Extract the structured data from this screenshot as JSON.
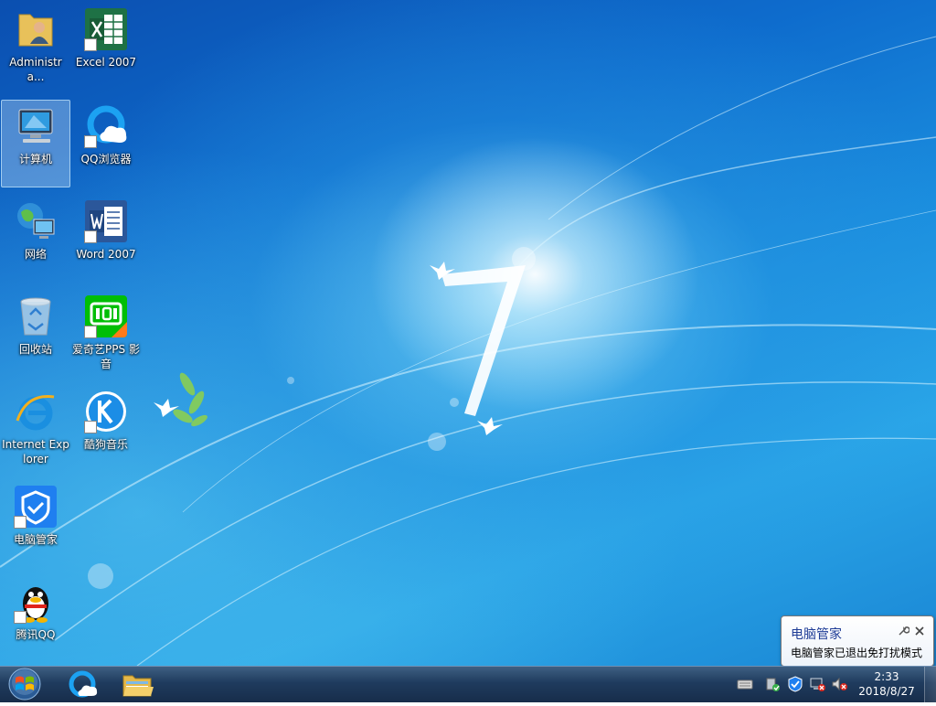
{
  "desktop_icons": [
    {
      "label": "Administra...",
      "icon": "user-folder-icon",
      "shortcut": false
    },
    {
      "label": "Excel 2007",
      "icon": "excel-icon",
      "shortcut": true
    },
    {
      "label": "计算机",
      "icon": "computer-icon",
      "shortcut": false,
      "selected": true
    },
    {
      "label": "QQ浏览器",
      "icon": "qq-browser-icon",
      "shortcut": true
    },
    {
      "label": "网络",
      "icon": "network-icon",
      "shortcut": false
    },
    {
      "label": "Word 2007",
      "icon": "word-icon",
      "shortcut": true
    },
    {
      "label": "回收站",
      "icon": "recycle-bin-icon",
      "shortcut": false
    },
    {
      "label": "爱奇艺PPS 影音",
      "icon": "iqiyi-icon",
      "shortcut": true
    },
    {
      "label": "Internet Explorer",
      "icon": "internet-explorer-icon",
      "shortcut": false
    },
    {
      "label": "酷狗音乐",
      "icon": "kugou-icon",
      "shortcut": true
    },
    {
      "label": "电脑管家",
      "icon": "pc-manager-icon",
      "shortcut": true
    },
    {
      "label": "腾讯QQ",
      "icon": "qq-penguin-icon",
      "shortcut": true
    }
  ],
  "taskbar": {
    "start_icon": "windows-logo-icon",
    "pinned": [
      {
        "name": "qq-browser",
        "icon": "qq-browser-icon"
      },
      {
        "name": "explorer",
        "icon": "file-explorer-icon"
      }
    ],
    "tray_icons": [
      "keyboard-icon",
      "usb-safe-remove-icon",
      "pc-manager-shield-icon",
      "network-disconnected-icon",
      "volume-muted-icon"
    ],
    "clock": {
      "time": "2:33",
      "date": "2018/8/27"
    }
  },
  "notification": {
    "title": "电脑管家",
    "message": "电脑管家已退出免打扰模式"
  },
  "colors": {
    "excel_green": "#1e7145",
    "word_blue": "#2b579a",
    "iqiyi_green": "#00be06",
    "ie_blue": "#1a8fe0",
    "pc_manager_blue": "#1f7ff0",
    "balloon_title": "#1e3c96"
  }
}
